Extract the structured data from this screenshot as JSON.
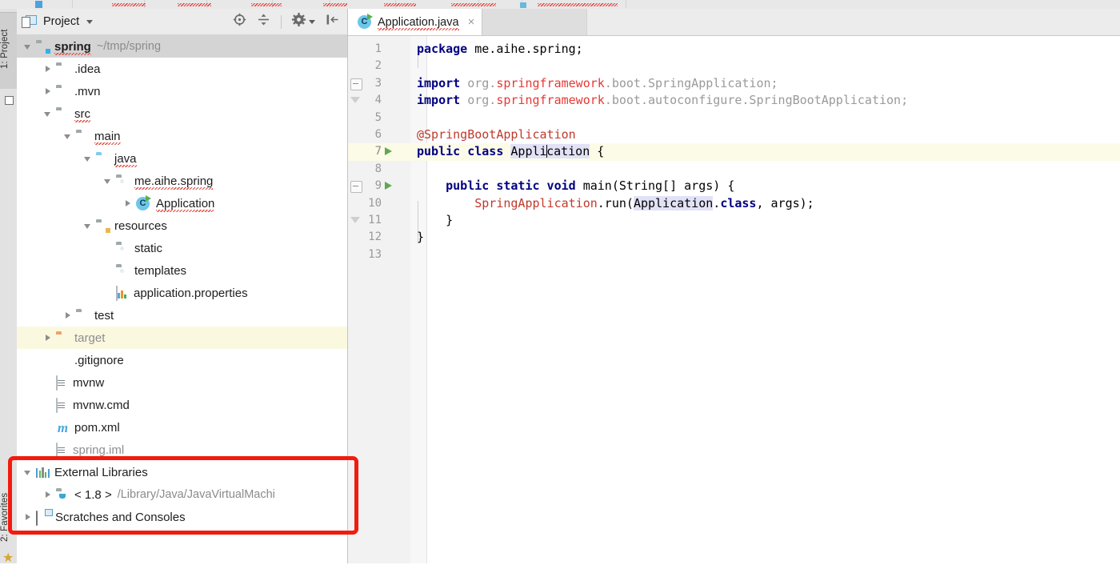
{
  "window": {
    "tool_strip": {
      "top_tab": "1: Project",
      "bottom_tab": "2: Favorites"
    }
  },
  "panel": {
    "title": "Project",
    "tools": [
      {
        "name": "locate-icon",
        "label": "Select Opened File"
      },
      {
        "name": "collapse-all-icon",
        "label": "Collapse All"
      },
      {
        "name": "gear-icon",
        "label": "Settings"
      },
      {
        "name": "hide-icon",
        "label": "Hide"
      }
    ]
  },
  "tree": {
    "items": [
      {
        "label": "spring",
        "path": "~/tmp/spring",
        "icon": "folder-module",
        "indent": 0,
        "arrow": "open",
        "state": "selected",
        "bold": true,
        "squiggly": true
      },
      {
        "label": ".idea",
        "path": "",
        "icon": "folder",
        "indent": 1,
        "arrow": "closed",
        "state": "",
        "bold": false,
        "squiggly": false
      },
      {
        "label": ".mvn",
        "path": "",
        "icon": "folder",
        "indent": 1,
        "arrow": "closed",
        "state": "",
        "bold": false,
        "squiggly": false
      },
      {
        "label": "src",
        "path": "",
        "icon": "folder",
        "indent": 1,
        "arrow": "open",
        "state": "",
        "bold": false,
        "squiggly": true
      },
      {
        "label": "main",
        "path": "",
        "icon": "folder",
        "indent": 2,
        "arrow": "open",
        "state": "",
        "bold": false,
        "squiggly": true
      },
      {
        "label": "java",
        "path": "",
        "icon": "folder-source",
        "indent": 3,
        "arrow": "open",
        "state": "",
        "bold": false,
        "squiggly": true
      },
      {
        "label": "me.aihe.spring",
        "path": "",
        "icon": "folder-package",
        "indent": 4,
        "arrow": "open",
        "state": "",
        "bold": false,
        "squiggly": true
      },
      {
        "label": "Application",
        "path": "",
        "icon": "java-class",
        "indent": 5,
        "arrow": "closed",
        "state": "",
        "bold": false,
        "squiggly": true
      },
      {
        "label": "resources",
        "path": "",
        "icon": "folder-resources",
        "indent": 3,
        "arrow": "open",
        "state": "",
        "bold": false,
        "squiggly": false
      },
      {
        "label": "static",
        "path": "",
        "icon": "folder-package",
        "indent": 4,
        "arrow": "none",
        "state": "",
        "bold": false,
        "squiggly": false
      },
      {
        "label": "templates",
        "path": "",
        "icon": "folder-package",
        "indent": 4,
        "arrow": "none",
        "state": "",
        "bold": false,
        "squiggly": false
      },
      {
        "label": "application.properties",
        "path": "",
        "icon": "properties-file",
        "indent": 4,
        "arrow": "none",
        "state": "",
        "bold": false,
        "squiggly": false
      },
      {
        "label": "test",
        "path": "",
        "icon": "folder",
        "indent": 2,
        "arrow": "closed",
        "state": "",
        "bold": false,
        "squiggly": false
      },
      {
        "label": "target",
        "path": "",
        "icon": "folder-excluded",
        "indent": 1,
        "arrow": "closed",
        "state": "excluded",
        "bold": false,
        "squiggly": false
      },
      {
        "label": ".gitignore",
        "path": "",
        "icon": "git-file",
        "indent": 1,
        "arrow": "none",
        "state": "",
        "bold": false,
        "squiggly": false
      },
      {
        "label": "mvnw",
        "path": "",
        "icon": "text-file",
        "indent": 1,
        "arrow": "none",
        "state": "",
        "bold": false,
        "squiggly": false
      },
      {
        "label": "mvnw.cmd",
        "path": "",
        "icon": "text-file",
        "indent": 1,
        "arrow": "none",
        "state": "",
        "bold": false,
        "squiggly": false
      },
      {
        "label": "pom.xml",
        "path": "",
        "icon": "maven-file",
        "indent": 1,
        "arrow": "none",
        "state": "",
        "bold": false,
        "squiggly": false
      },
      {
        "label": "spring.iml",
        "path": "",
        "icon": "module-file",
        "indent": 1,
        "arrow": "none",
        "state": "dimmed",
        "bold": false,
        "squiggly": false
      },
      {
        "label": "External Libraries",
        "path": "",
        "icon": "libraries",
        "indent": 0,
        "arrow": "open",
        "state": "",
        "bold": false,
        "squiggly": false
      },
      {
        "label": "< 1.8 >",
        "path": "/Library/Java/JavaVirtualMachi",
        "icon": "folder-jdk",
        "indent": 1,
        "arrow": "closed",
        "state": "",
        "bold": false,
        "squiggly": false
      },
      {
        "label": "Scratches and Consoles",
        "path": "",
        "icon": "scratches",
        "indent": 0,
        "arrow": "closed",
        "state": "",
        "bold": false,
        "squiggly": false
      }
    ]
  },
  "editor": {
    "tab": {
      "label": "Application.java",
      "icon": "java-class-icon",
      "close": "×"
    },
    "lines": [
      {
        "n": "1",
        "run": false,
        "fold": "",
        "html": "<span class='kw'>package</span> me.aihe.spring;"
      },
      {
        "n": "2",
        "run": false,
        "fold": "",
        "html": ""
      },
      {
        "n": "3",
        "run": false,
        "fold": "top",
        "html": "<span class='kw'>import</span> <span class='grey'>org.</span><span class='lit'>springframework</span><span class='grey'>.boot.SpringApplication;</span>"
      },
      {
        "n": "4",
        "run": false,
        "fold": "end",
        "html": "<span class='kw'>import</span> <span class='grey'>org.</span><span class='lit'>springframework</span><span class='grey'>.boot.autoconfigure.SpringBootApplication;</span>"
      },
      {
        "n": "5",
        "run": false,
        "fold": "",
        "html": ""
      },
      {
        "n": "6",
        "run": false,
        "fold": "",
        "html": "<span class='anno'>@SpringBootApplication</span>"
      },
      {
        "n": "7",
        "run": true,
        "fold": "",
        "html": "<span class='kw'>public class</span> <span class='ident'>Appli<span class='caret-bar'></span>cation</span> {",
        "highlight": true
      },
      {
        "n": "8",
        "run": false,
        "fold": "",
        "html": ""
      },
      {
        "n": "9",
        "run": true,
        "fold": "top",
        "html": "    <span class='kw'>public static void</span> main(String[] args) {"
      },
      {
        "n": "10",
        "run": false,
        "fold": "",
        "html": "        <span class='anno'>SpringApplication</span>.run(<span class='ident'>Application</span>.<span class='kw'>class</span>, args);"
      },
      {
        "n": "11",
        "run": false,
        "fold": "end",
        "html": "    }"
      },
      {
        "n": "12",
        "run": false,
        "fold": "",
        "html": "}"
      },
      {
        "n": "13",
        "run": false,
        "fold": "",
        "html": ""
      }
    ]
  },
  "annotation": {
    "type": "highlight-box",
    "color": "#f21b0f",
    "targets": [
      "External Libraries",
      "< 1.8 >",
      "Scratches and Consoles"
    ]
  },
  "colors": {
    "accent_blue": "#4aa3df",
    "folder_grey": "#9fa8ab",
    "folder_blue": "#7fcde8",
    "folder_orange": "#f0a06a",
    "keyword": "#000080",
    "annotation_red": "#c0392b",
    "selection_grey": "#d4d4d4",
    "excluded_yellow": "#fbf8e0",
    "highlight_line": "#fcfbe8",
    "box_red": "#f21b0f"
  }
}
